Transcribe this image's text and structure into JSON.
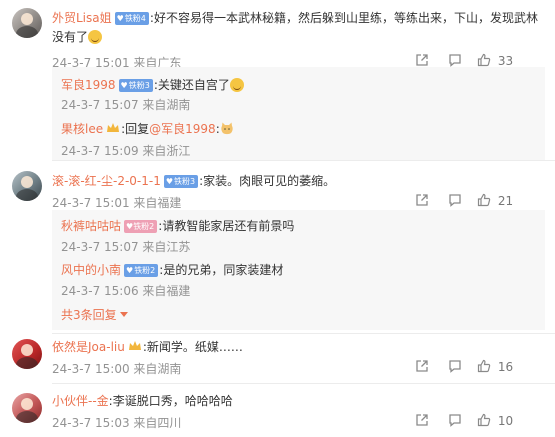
{
  "comments": [
    {
      "user": "外贸Lisa姐",
      "fan_level": "铁粉4",
      "text": ":好不容易得一本武林秘籍，然后躲到山里练，等练出来，下山，发现武林没有了",
      "meta": "24-3-7 15:01 来自广东",
      "likes": "33",
      "replies": [
        {
          "user": "军良1998",
          "fan_level": "铁粉3",
          "text": ":关键还自宫了",
          "meta": "24-3-7 15:07 来自湖南"
        },
        {
          "user": "果核lee",
          "text_prefix": ":回复",
          "mention": "@军良1998",
          "text_suffix": ":",
          "meta": "24-3-7 15:09 来自浙江"
        }
      ]
    },
    {
      "user": "滚-滚-红-尘-2-0-1-1",
      "fan_level": "铁粉3",
      "text": ":家装。肉眼可见的萎缩。",
      "meta": "24-3-7 15:01 来自福建",
      "likes": "21",
      "replies": [
        {
          "user": "秋裤咕咕咕",
          "fan_level": "铁粉2",
          "text": ":请教智能家居还有前景吗",
          "meta": "24-3-7 15:07 来自江苏"
        },
        {
          "user": "风中的小南",
          "fan_level": "铁粉2",
          "text": ":是的兄弟，同家装建材",
          "meta": "24-3-7 15:06 来自福建"
        }
      ],
      "more_label": "共3条回复"
    },
    {
      "user": "依然是Joa-liu",
      "text": ":新闻学。纸媒……",
      "meta": "24-3-7 15:00 来自湖南",
      "likes": "16"
    },
    {
      "user": "小伙伴--金",
      "text": ":李诞脱口秀，哈哈哈哈",
      "meta": "24-3-7 15:03 来自四川",
      "likes": "10"
    }
  ],
  "colors": {
    "username": "#eb7350",
    "meta": "#939393",
    "fan_badge": "#6a9fe6",
    "reply_bg": "#f7f7f7"
  },
  "icons": [
    "share-icon",
    "comment-icon",
    "like-icon",
    "crown-icon",
    "laugh-emoji",
    "cat-emoji"
  ]
}
